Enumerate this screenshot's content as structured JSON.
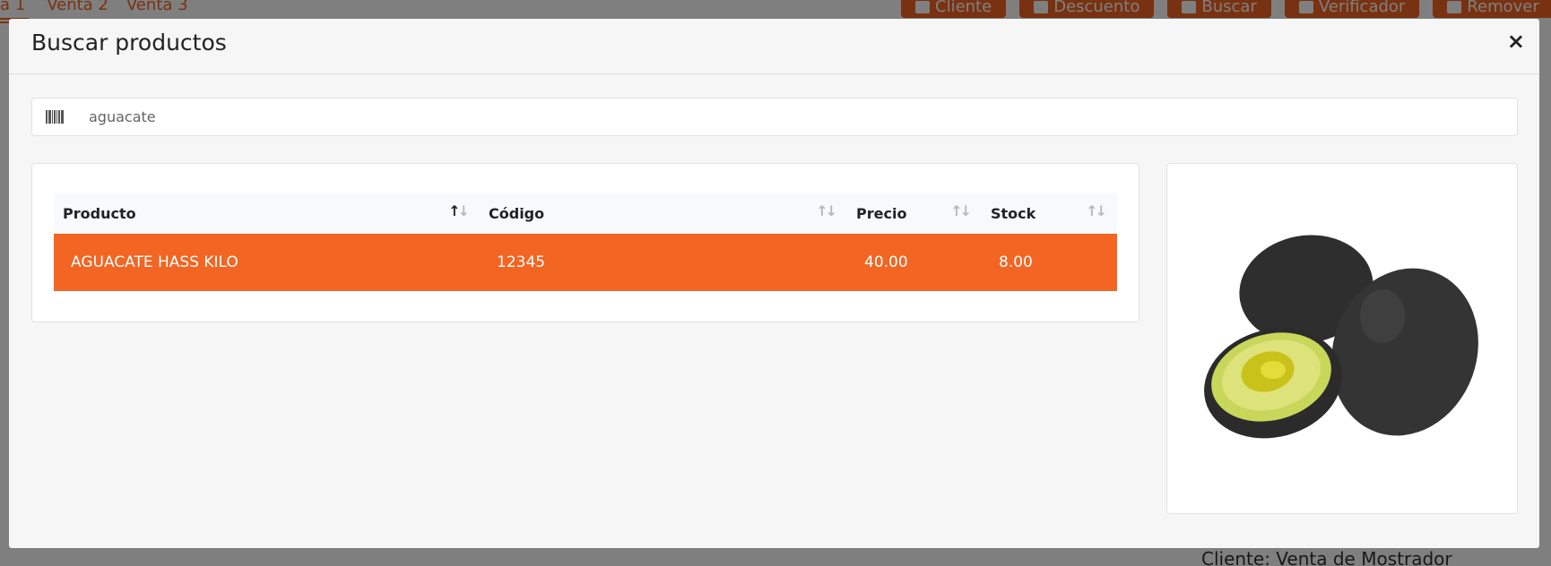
{
  "background": {
    "tabs": [
      "a 1",
      "Venta 2",
      "Venta 3"
    ],
    "toolbar": [
      "Cliente",
      "Descuento",
      "Buscar",
      "Verificador",
      "Remover"
    ],
    "client_label": "Cliente: Venta de Mostrador"
  },
  "modal": {
    "title": "Buscar productos",
    "close_label": "×",
    "search": {
      "value": "aguacate",
      "icon": "barcode-icon"
    },
    "table": {
      "columns": [
        "Producto",
        "Código",
        "Precio",
        "Stock"
      ],
      "rows": [
        {
          "producto": "AGUACATE HASS KILO",
          "codigo": "12345",
          "precio": "40.00",
          "stock": "8.00"
        }
      ]
    },
    "image": {
      "icon": "avocado-image"
    }
  },
  "colors": {
    "accent": "#f26522",
    "modal_bg": "#f6f6f6",
    "header_row_bg": "#f8f9fb"
  }
}
